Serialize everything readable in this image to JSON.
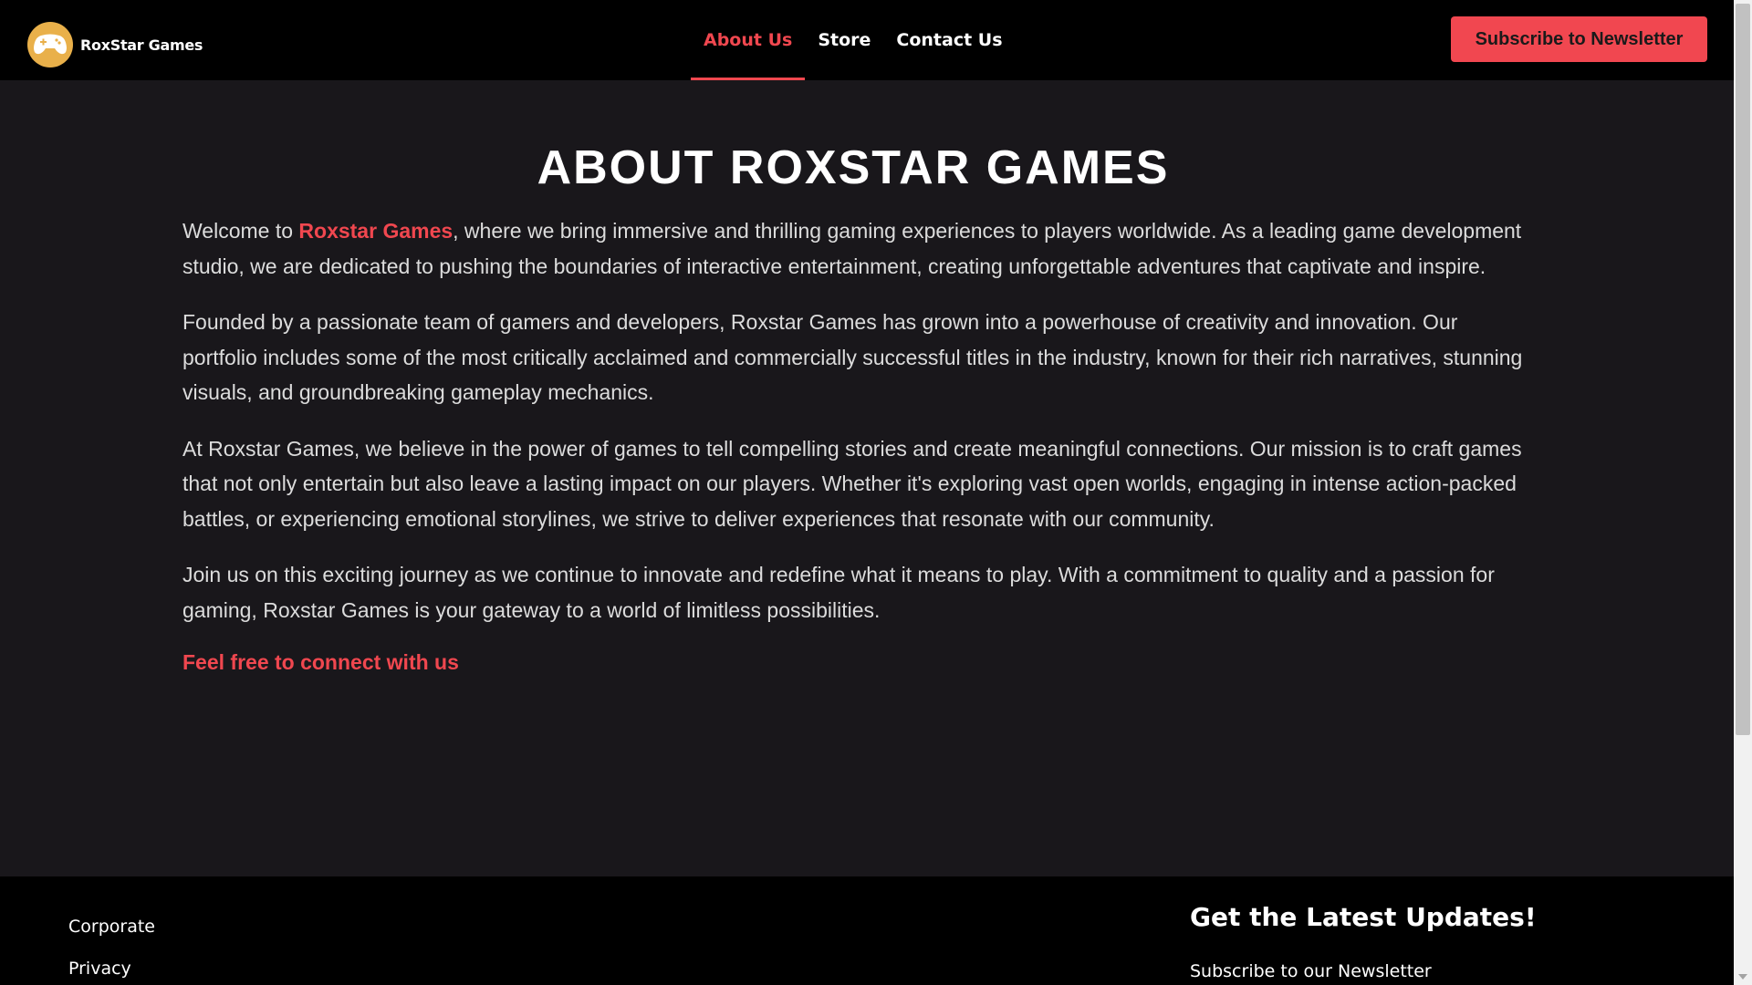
{
  "header": {
    "logo_text": "RoxStar Games",
    "nav": [
      {
        "label": "About Us",
        "active": true
      },
      {
        "label": "Store",
        "active": false
      },
      {
        "label": "Contact Us",
        "active": false
      }
    ],
    "subscribe_button": "Subscribe to Newsletter"
  },
  "main": {
    "title": "ABOUT ROXSTAR GAMES",
    "para1_prefix": "Welcome to ",
    "para1_brand": "Roxstar Games",
    "para1_rest": ", where we bring immersive and thrilling gaming experiences to players worldwide. As a leading game development studio, we are dedicated to pushing the boundaries of interactive entertainment, creating unforgettable adventures that captivate and inspire.",
    "para2": "Founded by a passionate team of gamers and developers, Roxstar Games has grown into a powerhouse of creativity and innovation. Our portfolio includes some of the most critically acclaimed and commercially successful titles in the industry, known for their rich narratives, stunning visuals, and groundbreaking gameplay mechanics.",
    "para3": "At Roxstar Games, we believe in the power of games to tell compelling stories and create meaningful connections. Our mission is to craft games that not only entertain but also leave a lasting impact on our players. Whether it's exploring vast open worlds, engaging in intense action-packed battles, or experiencing emotional storylines, we strive to deliver experiences that resonate with our community.",
    "para4": "Join us on this exciting journey as we continue to innovate and redefine what it means to play. With a commitment to quality and a passion for gaming, Roxstar Games is your gateway to a world of limitless possibilities.",
    "connect_link": "Feel free to connect with us"
  },
  "footer": {
    "links": [
      "Corporate",
      "Privacy"
    ],
    "heading": "Get the Latest Updates!",
    "subheading": "Subscribe to our Newsletter"
  },
  "colors": {
    "accent": "#f0474f",
    "background": "#19171b",
    "header_bg": "#000000",
    "logo_bg": "#e9b04a"
  },
  "icons": {
    "logo": "gamepad-icon"
  }
}
